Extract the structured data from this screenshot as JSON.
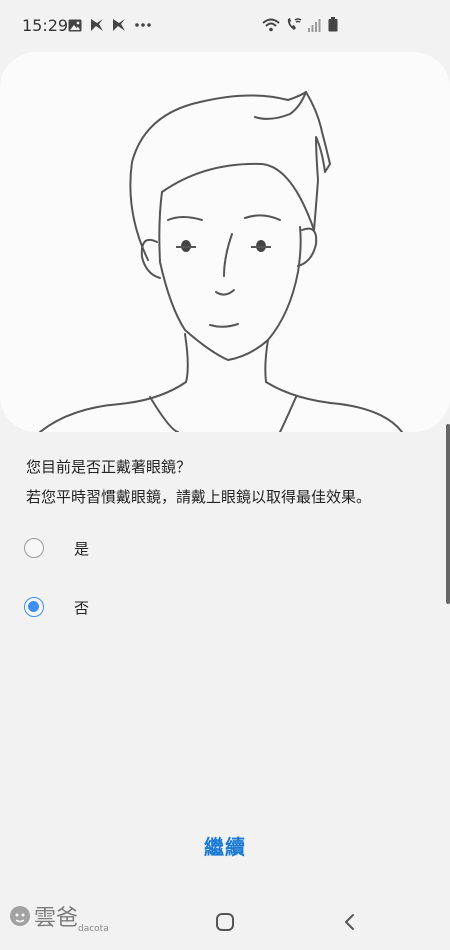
{
  "status_bar": {
    "time": "15:29",
    "left_icons": [
      "image-icon",
      "app-notification-icon",
      "app-notification-icon-2",
      "more-dots-icon"
    ],
    "right_icons": [
      "wifi-icon",
      "wifi-calling-icon",
      "signal-icon",
      "battery-icon"
    ]
  },
  "illustration": {
    "icon": "face-illustration"
  },
  "prompt": {
    "question": "您目前是否正戴著眼鏡？",
    "hint": "若您平時習慣戴眼鏡，請戴上眼鏡以取得最佳效果。"
  },
  "options": [
    {
      "label": "是",
      "selected": false
    },
    {
      "label": "否",
      "selected": true
    }
  ],
  "continue_label": "繼續",
  "accent_color": "#3e8ef3",
  "link_color": "#1d7ad6",
  "navigation": {
    "home_icon": "home-icon",
    "back_icon": "back-icon"
  },
  "watermark": {
    "text": "雲爸",
    "sub": "dacota"
  }
}
